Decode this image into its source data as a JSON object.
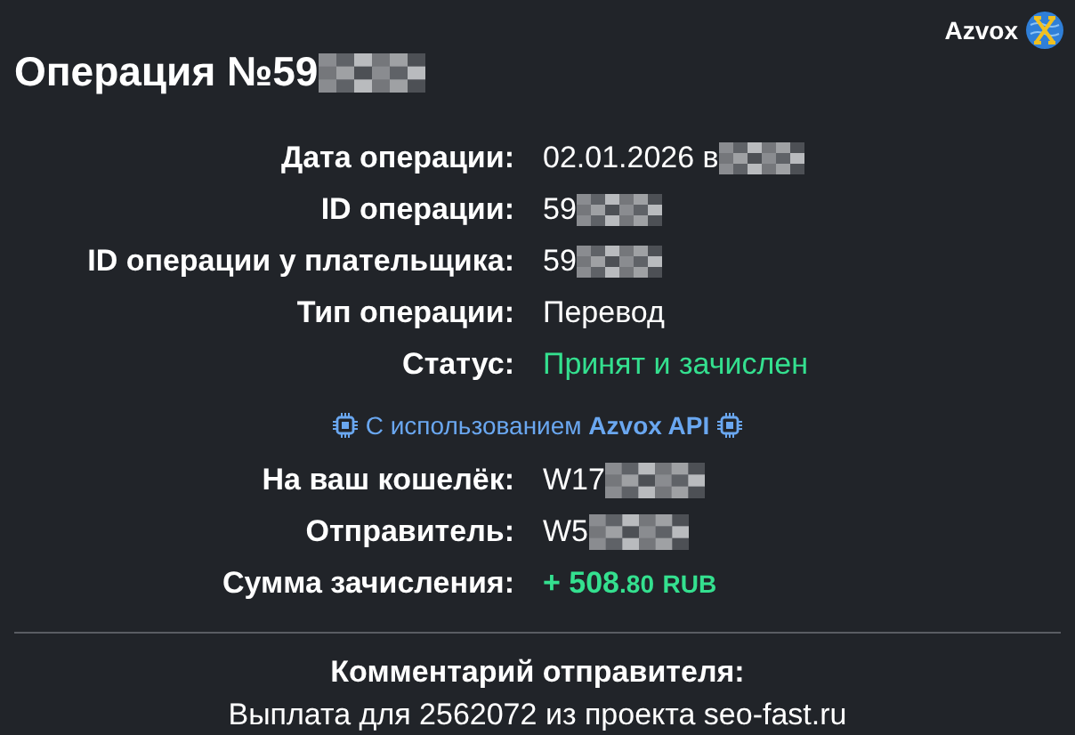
{
  "brand": {
    "name": "Azvox"
  },
  "title": {
    "text": "Операция №59",
    "redacted": true
  },
  "details": [
    {
      "label": "Дата операции:",
      "value": "02.01.2026 в ",
      "redacted": true,
      "kind": "plain"
    },
    {
      "label": "ID операции:",
      "value": "59",
      "redacted": true,
      "kind": "plain"
    },
    {
      "label": "ID операции у плательщика:",
      "value": "59",
      "redacted": true,
      "kind": "plain"
    },
    {
      "label": "Тип операции:",
      "value": "Перевод",
      "kind": "plain"
    },
    {
      "label": "Статус:",
      "value": "Принят и зачислен",
      "kind": "status"
    }
  ],
  "api_note": {
    "text": "С использованием **Azvox API**"
  },
  "parties": [
    {
      "label": "На ваш кошелёк:",
      "value": "W17",
      "redacted": true
    },
    {
      "label": "Отправитель:",
      "value": "W5",
      "redacted": true
    }
  ],
  "amount": {
    "label": "Сумма зачисления:",
    "main": "+ 508",
    "fraction": ".80",
    "currency": "RUB"
  },
  "comment": {
    "title": "Комментарий отправителя:",
    "text": "Выплата для 2562072 из проекта seo-fast.ru"
  }
}
